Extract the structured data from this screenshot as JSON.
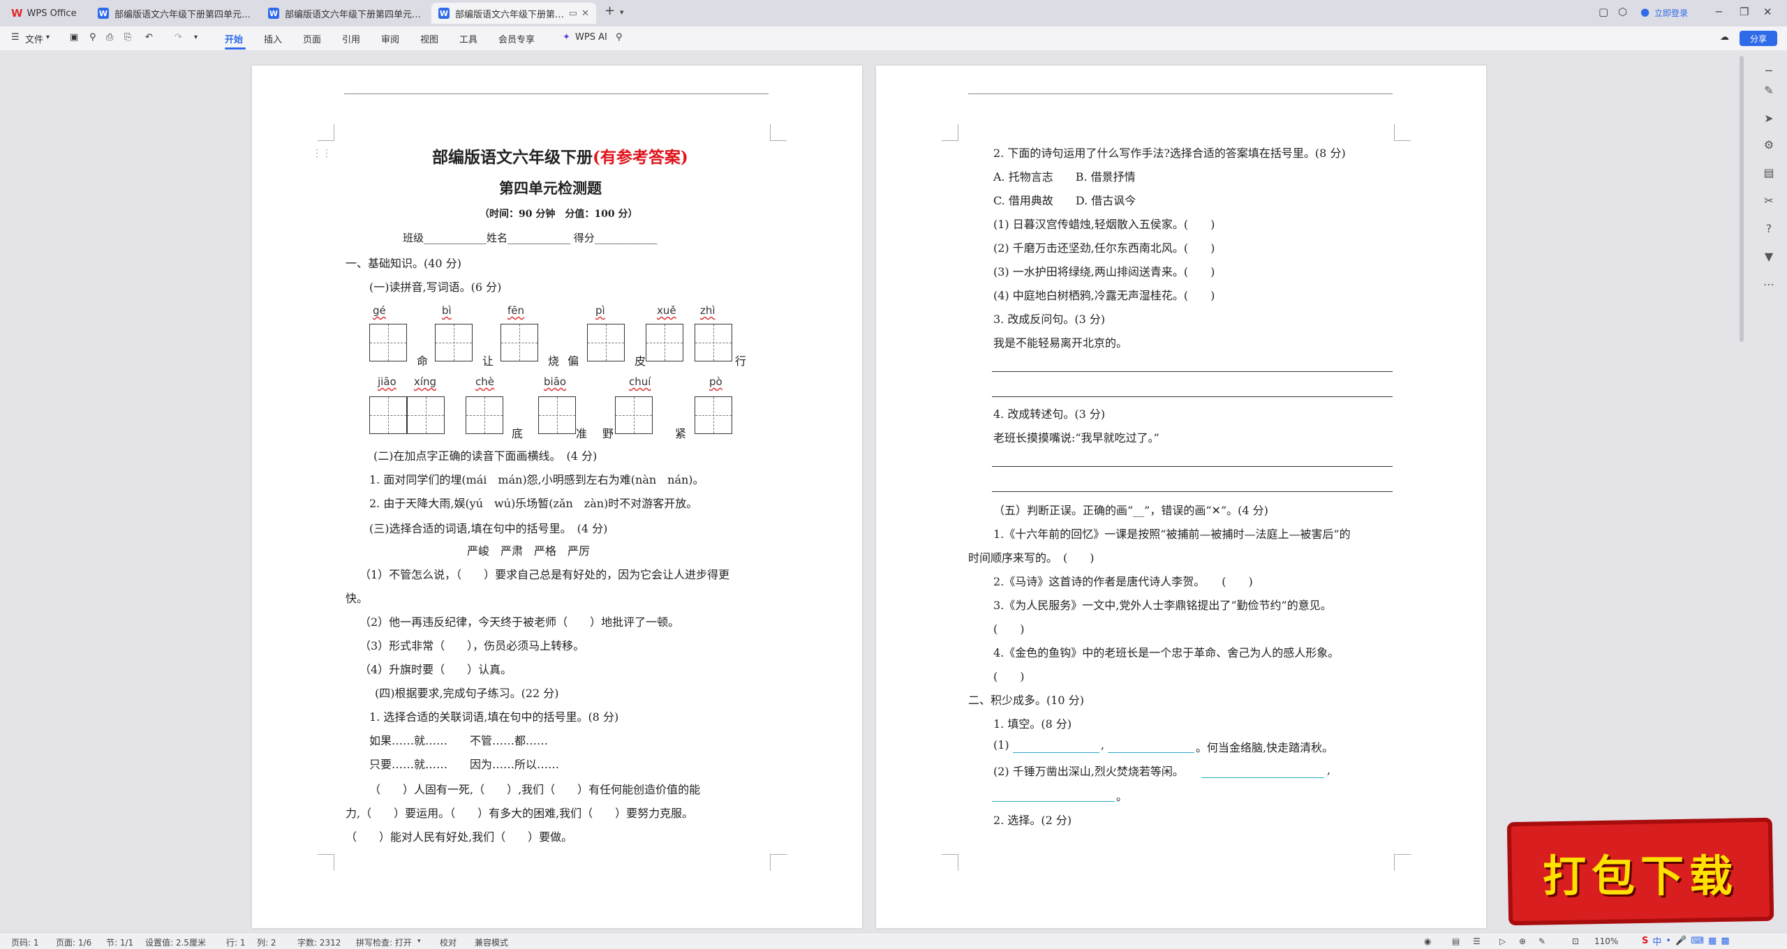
{
  "titlebar": {
    "tabs": [
      {
        "label": "WPS Office",
        "active": false
      },
      {
        "label": "部编版语文六年级下册第四单元 综合...",
        "active": false
      },
      {
        "label": "部编版语文六年级下册第四单元测试卷...",
        "active": false
      },
      {
        "label": "部编版语文六年级下册第四单元...",
        "active": true
      }
    ],
    "new_tab": "+",
    "login": "立即登录"
  },
  "toolbar": {
    "file_label": "文件",
    "menus": [
      "开始",
      "插入",
      "页面",
      "引用",
      "审阅",
      "视图",
      "工具",
      "会员专享"
    ],
    "wps_ai": "WPS AI",
    "share": "分享"
  },
  "page1": {
    "title_main": "部编版语文六年级下册",
    "title_tag": "(有参考答案)",
    "subtitle": "第四单元检测题",
    "time_score": "（时间：90 分钟　分值：100 分）",
    "student_line": "班级____________姓名____________ 得分____________",
    "section1": "一、基础知识。(40 分)",
    "part1": "(一)读拼音,写词语。(6 分)",
    "row1_pinyin": [
      "gé",
      "bì",
      "fēn",
      "pì",
      "xuě",
      "zhì"
    ],
    "row1_chars": [
      "命",
      "让",
      "烧",
      "偏",
      "皮",
      "行"
    ],
    "row2_pinyin": [
      "jiāo",
      "xíng",
      "chè",
      "biāo",
      "chuí",
      "pò"
    ],
    "row2_chars": [
      "底",
      "准",
      "野",
      "紧"
    ],
    "part2": "(二)在加点字正确的读音下面画横线。　(4 分)",
    "part2_q1": "1. 面对同学们的埋(mái　mán)怨,小明感到左右为难(nàn　nán)。",
    "part2_q2": "2. 由于天降大雨,娱(yú　wú)乐场暂(zǎn　zàn)时不对游客开放。",
    "part3": "(三)选择合适的词语,填在句中的括号里。　(4 分)",
    "part3_words": "严峻　严肃　严格　严厉",
    "part3_q1a": "（1）不管怎么说，（　　）要求自己总是有好处的，因为它会让人进步得更",
    "part3_q1b": "快。",
    "part3_q2": "（2）他一再违反纪律，今天终于被老师（　　）地批评了一顿。",
    "part3_q3": "（3）形式非常（　　），伤员必须马上转移。",
    "part3_q4": "（4）升旗时要（　　）认真。",
    "part4": "(四)根据要求,完成句子练习。(22 分)",
    "part4_q1": "1. 选择合适的关联词语,填在句中的括号里。(8 分)",
    "conj_row1": "如果……就……　　不管……都……",
    "conj_row2": "只要……就……　　因为……所以……",
    "part4_s1": "（　　）人固有一死,（　　）,我们（　　）有任何能创造价值的能",
    "part4_s2": "力,（　　）要运用。（　　）有多大的困难,我们（　　）要努力克服。",
    "part4_s3": "（　　）能对人民有好处,我们（　　）要做。"
  },
  "page2": {
    "q2": "2. 下面的诗句运用了什么写作手法?选择合适的答案填在括号里。(8 分)",
    "opt_ab": "A. 托物言志　　B. 借景抒情",
    "opt_cd": "C. 借用典故　　D. 借古讽今",
    "poem1": "(1) 日暮汉宫传蜡烛,轻烟散入五侯家。(　　)",
    "poem2": "(2) 千磨万击还坚劲,任尔东西南北风。(　　)",
    "poem3": "(3) 一水护田将绿绕,两山排闼送青来。(　　)",
    "poem4": "(4) 中庭地白树栖鸦,冷露无声湿桂花。(　　)",
    "q3": "3. 改成反问句。(3 分)",
    "q3_sentence": "我是不能轻易离开北京的。",
    "q4": "4. 改成转述句。(3 分)",
    "q4_sentence": "老班长摸摸嘴说:“我早就吃过了。”",
    "part5": "（五）判断正误。正确的画“__”，错误的画“✕”。(4 分)",
    "j1a": "1.《十六年前的回忆》一课是按照“被捕前—被捕时—法庭上—被害后”的",
    "j1b": "时间顺序来写的。　(　　)",
    "j2": "2.《马诗》这首诗的作者是唐代诗人李贺。　　(　　)",
    "j3a": "3.《为人民服务》一文中,党外人士李鼎铭提出了“勤俭节约”的意见。",
    "j3b": "(　　)",
    "j4a": "4.《金色的鱼钩》中的老班长是一个忠于革命、舍己为人的感人形象。",
    "j4b": "(　　)",
    "section2": "二、积少成多。(10 分)",
    "fill": "1. 填空。(8 分)",
    "fill1_pre": "(1)",
    "fill1_sep": ",",
    "fill1_post": "。何当金络脑,快走踏清秋。",
    "fill2": "(2) 千锤万凿出深山,烈火焚烧若等闲。",
    "fill2_comma": ",",
    "fill2_end": "。",
    "choose": "2. 选择。(2 分)"
  },
  "statusbar": {
    "page_code": "页码: 1",
    "page_of": "页面: 1/6",
    "section": "节: 1/1",
    "setting": "设置值: 2.5厘米",
    "row": "行: 1",
    "col": "列: 2",
    "words": "字数: 2312",
    "spell": "拼写检查: 打开",
    "proof": "校对",
    "compat": "兼容模式",
    "zoom": "110%"
  },
  "promo": {
    "text": "打包下载"
  },
  "ime": {
    "label": "中"
  }
}
